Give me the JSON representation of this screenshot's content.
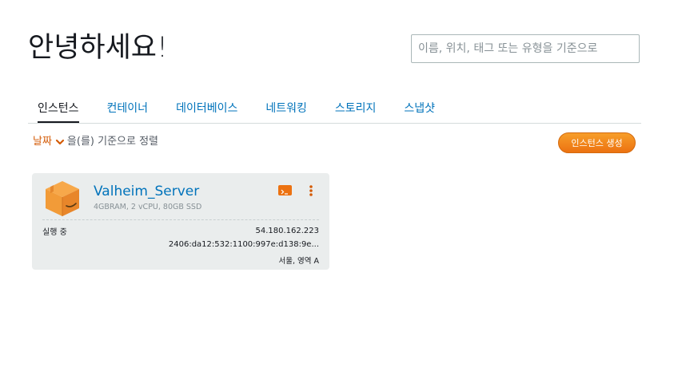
{
  "header": {
    "greeting": "안녕하세요!",
    "search_placeholder": "이름, 위치, 태그 또는 유형을 기준으로"
  },
  "tabs": [
    {
      "label": "인스턴스",
      "active": true
    },
    {
      "label": "컨테이너",
      "active": false
    },
    {
      "label": "데이터베이스",
      "active": false
    },
    {
      "label": "네트워킹",
      "active": false
    },
    {
      "label": "스토리지",
      "active": false
    },
    {
      "label": "스냅샷",
      "active": false
    }
  ],
  "sort": {
    "key": "날짜",
    "suffix": "을(를) 기준으로 정렬"
  },
  "actions": {
    "create_label": "인스턴스 생성"
  },
  "instance": {
    "name": "Valheim_Server",
    "spec": "4GBRAM, 2 vCPU, 80GB SSD",
    "status": "실행 중",
    "ipv4": "54.180.162.223",
    "ipv6": "2406:da12:532:1100:997e:d138:9e...",
    "region": "서울, 영역 A"
  },
  "icons": {
    "instance": "box-icon",
    "terminal": "terminal-icon",
    "more": "more-vertical-icon",
    "sort": "chevron-down-icon"
  },
  "colors": {
    "accent": "#ec7211",
    "link": "#0073bb",
    "card_bg": "#eaeded"
  }
}
